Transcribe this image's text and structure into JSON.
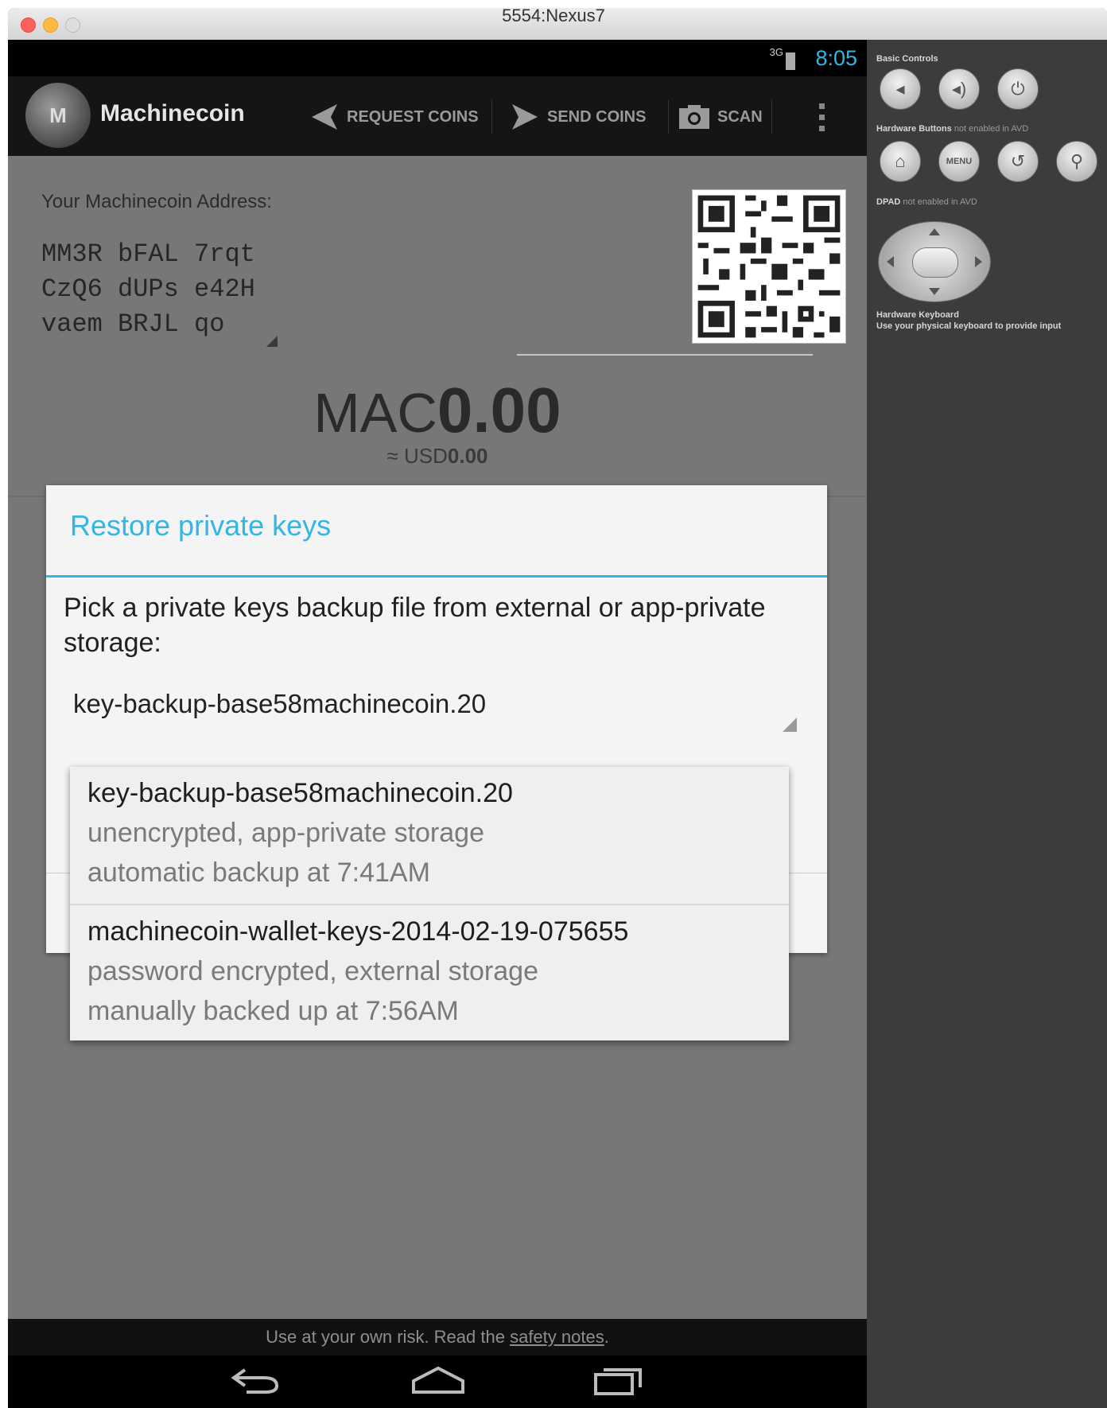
{
  "window": {
    "title": "5554:Nexus7"
  },
  "statusbar": {
    "signal": "3G",
    "time": "8:05"
  },
  "actionbar": {
    "app_name": "Machinecoin",
    "request_coins": "REQUEST COINS",
    "send_coins": "SEND COINS",
    "scan": "SCAN",
    "logo_text": "M",
    "icons": {
      "request": "arrow-left-icon",
      "send": "arrow-right-icon",
      "scan": "camera-icon",
      "overflow": "overflow-menu-icon"
    }
  },
  "address": {
    "label": "Your Machinecoin Address:",
    "lines": [
      "MM3R bFAL 7rqt",
      "CzQ6 dUPs e42H",
      "vaem BRJL qo"
    ]
  },
  "balance": {
    "currency": "MAC",
    "amount": "0.00",
    "fiat_prefix": "≈ USD",
    "fiat_amount": "0.00"
  },
  "dialog": {
    "title": "Restore private keys",
    "message": "Pick a private keys backup file from external or app-private storage:",
    "selected_file": "key-backup-base58machinecoin.20",
    "files": [
      {
        "name": "key-backup-base58machinecoin.20",
        "line1": "unencrypted, app-private storage",
        "line2": "automatic backup at 7:41AM"
      },
      {
        "name": "machinecoin-wallet-keys-2014-02-19-075655",
        "line1": "password encrypted, external storage",
        "line2": "manually backed up at 7:56AM"
      }
    ]
  },
  "footer": {
    "text": "Use at your own risk. Read the ",
    "link": "safety notes",
    "end": "."
  },
  "emulator_panel": {
    "basic_controls": "Basic Controls",
    "hw_buttons": "Hardware Buttons",
    "hw_buttons_note": "not enabled in AVD",
    "dpad": "DPAD",
    "dpad_note": "not enabled in AVD",
    "hw_keyboard": "Hardware Keyboard",
    "hw_keyboard_note": "Use your physical keyboard to provide input",
    "menu_label": "MENU"
  },
  "colors": {
    "accent": "#33b5e5",
    "action_bar": "#151515",
    "dim_background": "#777777"
  }
}
